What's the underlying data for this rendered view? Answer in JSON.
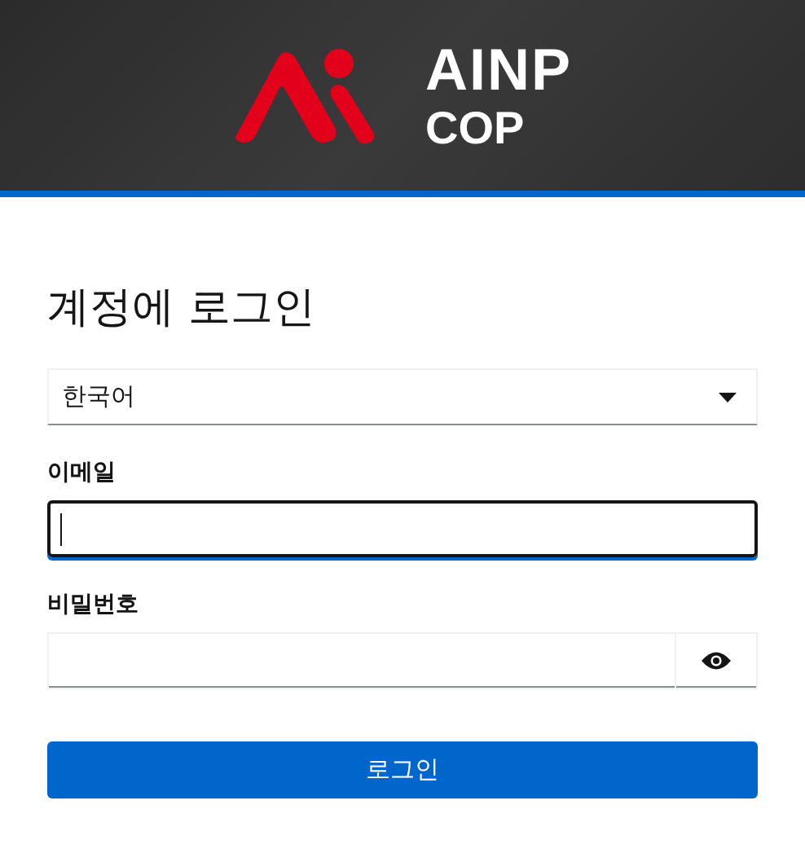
{
  "header": {
    "logo_line_1": "AINP",
    "logo_line_2": "COP"
  },
  "title": "계정에 로그인",
  "language_select": {
    "value": "한국어"
  },
  "fields": [
    {
      "label": "이메일",
      "kind": "text",
      "focused": true
    },
    {
      "label": "비밀번호",
      "kind": "password",
      "focused": false
    }
  ],
  "submit_button": "로그인"
}
